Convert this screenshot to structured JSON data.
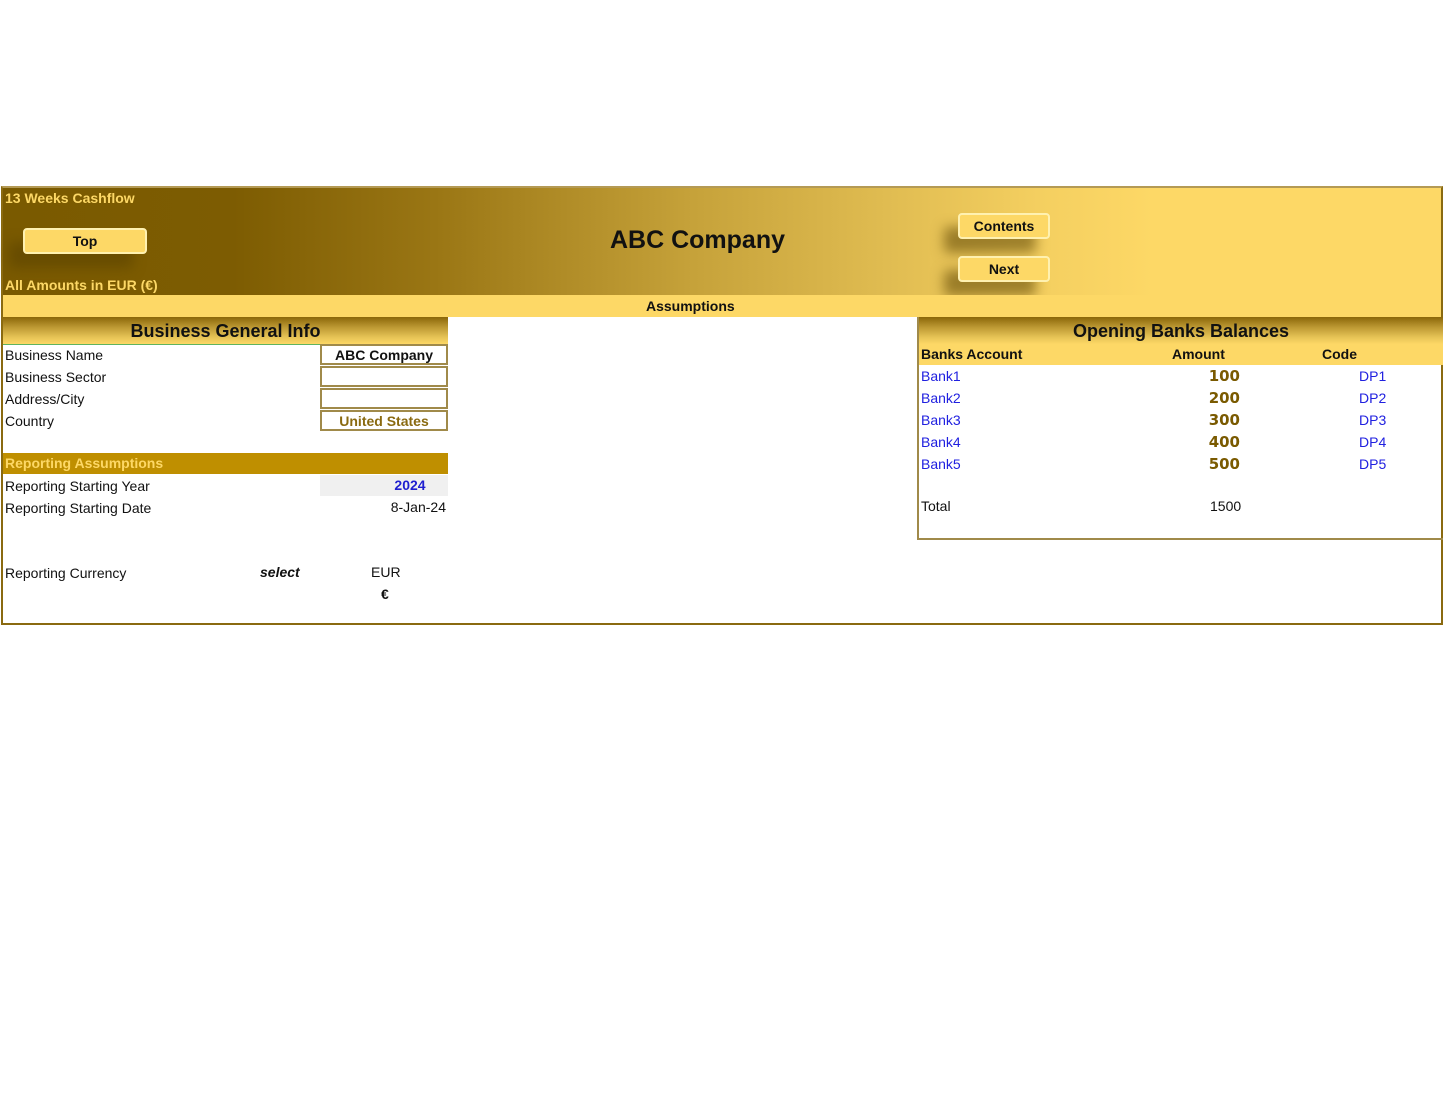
{
  "header": {
    "workbook_title": "13 Weeks Cashflow",
    "amounts_note": "All Amounts in  EUR (€)",
    "company_title": "ABC Company",
    "buttons": {
      "top": "Top",
      "contents": "Contents",
      "next": "Next"
    },
    "sheet_name": "Assumptions"
  },
  "general_info": {
    "title": "Business General Info",
    "fields": [
      {
        "label": "Business Name",
        "value": "ABC Company"
      },
      {
        "label": "Business Sector",
        "value": ""
      },
      {
        "label": "Address/City",
        "value": ""
      },
      {
        "label": "Country",
        "value": "United States"
      }
    ]
  },
  "reporting": {
    "title": "Reporting Assumptions",
    "starting_year_label": "Reporting Starting Year",
    "starting_year": "2024",
    "starting_date_label": "Reporting Starting Date",
    "starting_date": "8-Jan-24",
    "currency_label": "Reporting Currency",
    "select_label": "select",
    "currency_code": "EUR",
    "currency_symbol": "€"
  },
  "banks": {
    "title": "Opening Banks Balances",
    "columns": [
      "Banks Account",
      "Amount",
      "Code"
    ],
    "rows": [
      {
        "name": "Bank1",
        "amount": "100",
        "code": "DP1"
      },
      {
        "name": "Bank2",
        "amount": "200",
        "code": "DP2"
      },
      {
        "name": "Bank3",
        "amount": "300",
        "code": "DP3"
      },
      {
        "name": "Bank4",
        "amount": "400",
        "code": "DP4"
      },
      {
        "name": "Bank5",
        "amount": "500",
        "code": "DP5"
      }
    ],
    "total_label": "Total",
    "total_value": "1500"
  },
  "colors": {
    "gold_dark": "#7a5a00",
    "gold_light": "#fdd866",
    "section_gold": "#bf8f00",
    "link_blue": "#2020e0"
  }
}
